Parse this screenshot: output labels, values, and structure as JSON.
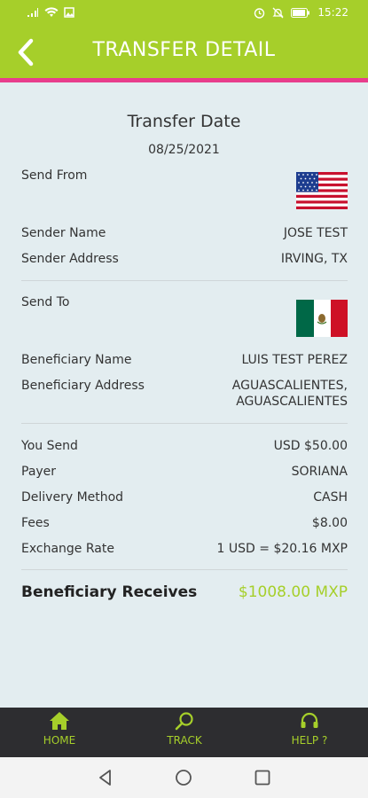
{
  "status_bar": {
    "time": "15:22"
  },
  "header": {
    "title": "TRANSFER DETAIL"
  },
  "transfer": {
    "date_label": "Transfer Date",
    "date_value": "08/25/2021"
  },
  "sender": {
    "send_from_label": "Send From",
    "flag_icon": "usa-flag-icon",
    "name_label": "Sender Name",
    "name_value": "JOSE TEST",
    "address_label": "Sender Address",
    "address_value": "IRVING, TX"
  },
  "beneficiary": {
    "send_to_label": "Send To",
    "flag_icon": "mexico-flag-icon",
    "name_label": "Beneficiary Name",
    "name_value": "LUIS TEST PEREZ",
    "address_label": "Beneficiary Address",
    "address_line1": "AGUASCALIENTES,",
    "address_line2": "AGUASCALIENTES"
  },
  "amounts": {
    "you_send_label": "You Send",
    "you_send_value": "USD $50.00",
    "payer_label": "Payer",
    "payer_value": "SORIANA",
    "delivery_label": "Delivery Method",
    "delivery_value": "CASH",
    "fees_label": "Fees",
    "fees_value": "$8.00",
    "rate_label": "Exchange Rate",
    "rate_value": "1 USD = $20.16 MXP",
    "receives_label": "Beneficiary Receives",
    "receives_value": "$1008.00 MXP"
  },
  "bottom_nav": {
    "home": "HOME",
    "track": "TRACK",
    "help": "HELP ?"
  },
  "colors": {
    "accent": "#a6cf2a",
    "pink": "#e83e8c",
    "background": "#e3edf0",
    "nav": "#2d2d30"
  }
}
